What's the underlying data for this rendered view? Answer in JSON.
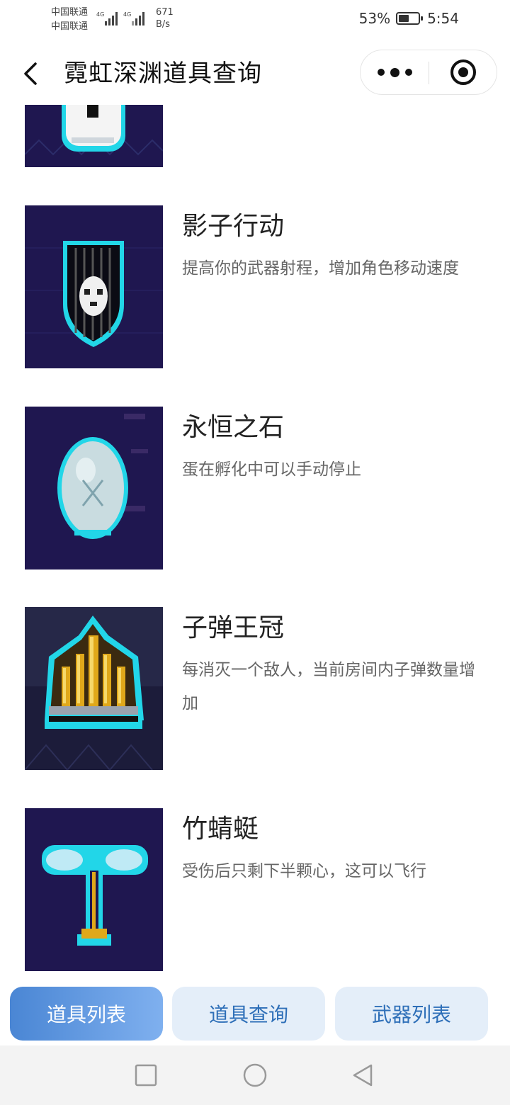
{
  "status_bar": {
    "carrier_1": "中国联通",
    "carrier_2": "中国联通",
    "network_1": "4G",
    "network_2": "4G",
    "net_speed_value": "671",
    "net_speed_unit": "B/s",
    "battery_percent": "53%",
    "battery_level": 0.53,
    "time": "5:54"
  },
  "nav": {
    "title": "霓虹深渊道具查询"
  },
  "items": [
    {
      "name": "影子行动",
      "desc": "提高你的武器射程，增加角色移动速度",
      "icon": "shadow-shield-icon"
    },
    {
      "name": "永恒之石",
      "desc": "蛋在孵化中可以手动停止",
      "icon": "eternal-stone-egg-icon"
    },
    {
      "name": "子弹王冠",
      "desc": "每消灭一个敌人，当前房间内子弹数量增加",
      "icon": "bullet-crown-icon"
    },
    {
      "name": "竹蜻蜓",
      "desc": "受伤后只剩下半颗心，这可以飞行",
      "icon": "bamboo-copter-icon"
    }
  ],
  "tabs": [
    {
      "label": "道具列表",
      "active": true
    },
    {
      "label": "道具查询",
      "active": false
    },
    {
      "label": "武器列表",
      "active": false
    }
  ],
  "colors": {
    "thumb_bg": "#1f1750",
    "neon_cyan": "#22d6e8",
    "tab_active_start": "#4a86d4",
    "tab_active_end": "#7fb0ef",
    "tab_inactive_bg": "#e4eef9",
    "tab_inactive_text": "#2e6fb8"
  }
}
